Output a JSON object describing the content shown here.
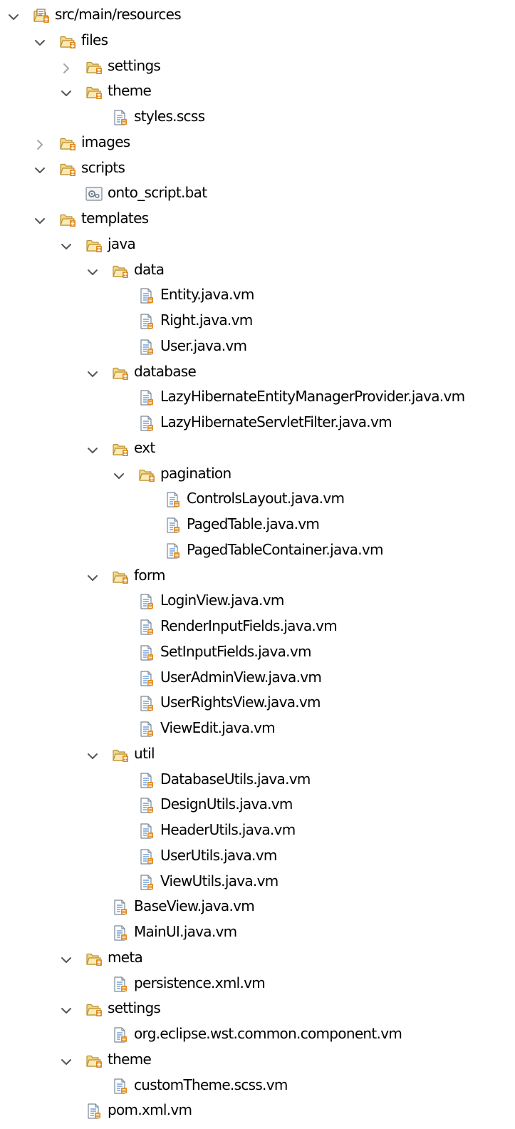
{
  "tree": {
    "nodes": [
      {
        "label": "src/main/resources",
        "depth": 0,
        "kind": "source-folder",
        "expanded": true
      },
      {
        "label": "files",
        "depth": 1,
        "kind": "folder",
        "expanded": true
      },
      {
        "label": "settings",
        "depth": 2,
        "kind": "folder",
        "expanded": false
      },
      {
        "label": "theme",
        "depth": 2,
        "kind": "folder",
        "expanded": true
      },
      {
        "label": "styles.scss",
        "depth": 3,
        "kind": "file"
      },
      {
        "label": "images",
        "depth": 1,
        "kind": "folder",
        "expanded": false
      },
      {
        "label": "scripts",
        "depth": 1,
        "kind": "folder",
        "expanded": true
      },
      {
        "label": "onto_script.bat",
        "depth": 2,
        "kind": "script-file"
      },
      {
        "label": "templates",
        "depth": 1,
        "kind": "folder",
        "expanded": true
      },
      {
        "label": "java",
        "depth": 2,
        "kind": "folder",
        "expanded": true
      },
      {
        "label": "data",
        "depth": 3,
        "kind": "folder",
        "expanded": true
      },
      {
        "label": "Entity.java.vm",
        "depth": 4,
        "kind": "file"
      },
      {
        "label": "Right.java.vm",
        "depth": 4,
        "kind": "file"
      },
      {
        "label": "User.java.vm",
        "depth": 4,
        "kind": "file"
      },
      {
        "label": "database",
        "depth": 3,
        "kind": "folder",
        "expanded": true
      },
      {
        "label": "LazyHibernateEntityManagerProvider.java.vm",
        "depth": 4,
        "kind": "file"
      },
      {
        "label": "LazyHibernateServletFilter.java.vm",
        "depth": 4,
        "kind": "file"
      },
      {
        "label": "ext",
        "depth": 3,
        "kind": "folder",
        "expanded": true
      },
      {
        "label": "pagination",
        "depth": 4,
        "kind": "folder",
        "expanded": true
      },
      {
        "label": "ControlsLayout.java.vm",
        "depth": 5,
        "kind": "file"
      },
      {
        "label": "PagedTable.java.vm",
        "depth": 5,
        "kind": "file"
      },
      {
        "label": "PagedTableContainer.java.vm",
        "depth": 5,
        "kind": "file"
      },
      {
        "label": "form",
        "depth": 3,
        "kind": "folder",
        "expanded": true
      },
      {
        "label": "LoginView.java.vm",
        "depth": 4,
        "kind": "file"
      },
      {
        "label": "RenderInputFields.java.vm",
        "depth": 4,
        "kind": "file"
      },
      {
        "label": "SetInputFields.java.vm",
        "depth": 4,
        "kind": "file"
      },
      {
        "label": "UserAdminView.java.vm",
        "depth": 4,
        "kind": "file"
      },
      {
        "label": "UserRightsView.java.vm",
        "depth": 4,
        "kind": "file"
      },
      {
        "label": "ViewEdit.java.vm",
        "depth": 4,
        "kind": "file"
      },
      {
        "label": "util",
        "depth": 3,
        "kind": "folder",
        "expanded": true
      },
      {
        "label": "DatabaseUtils.java.vm",
        "depth": 4,
        "kind": "file"
      },
      {
        "label": "DesignUtils.java.vm",
        "depth": 4,
        "kind": "file"
      },
      {
        "label": "HeaderUtils.java.vm",
        "depth": 4,
        "kind": "file"
      },
      {
        "label": "UserUtils.java.vm",
        "depth": 4,
        "kind": "file"
      },
      {
        "label": "ViewUtils.java.vm",
        "depth": 4,
        "kind": "file"
      },
      {
        "label": "BaseView.java.vm",
        "depth": 3,
        "kind": "file"
      },
      {
        "label": "MainUI.java.vm",
        "depth": 3,
        "kind": "file"
      },
      {
        "label": "meta",
        "depth": 2,
        "kind": "folder",
        "expanded": true
      },
      {
        "label": "persistence.xml.vm",
        "depth": 3,
        "kind": "file"
      },
      {
        "label": "settings",
        "depth": 2,
        "kind": "folder",
        "expanded": true
      },
      {
        "label": "org.eclipse.wst.common.component.vm",
        "depth": 3,
        "kind": "file"
      },
      {
        "label": "theme",
        "depth": 2,
        "kind": "folder",
        "expanded": true
      },
      {
        "label": "customTheme.scss.vm",
        "depth": 3,
        "kind": "file"
      },
      {
        "label": "pom.xml.vm",
        "depth": 2,
        "kind": "file"
      }
    ]
  },
  "colors": {
    "text": "#000000",
    "chevron": "#555555",
    "chevron_collapsed": "#a6a6a6",
    "folder_fill": "#f5d78a",
    "folder_stroke": "#b8902f",
    "folder_light": "#fbe9b6",
    "badge": "#e08a1c",
    "file_fill": "#ffffff",
    "file_stroke": "#7a8896",
    "file_lines": "#5b8fd0",
    "script_gear": "#6d7a88"
  },
  "icons": {
    "source-folder": "package-folder-icon",
    "folder": "folder-icon",
    "file": "text-file-icon",
    "script-file": "script-file-icon",
    "expanded": "chevron-down-icon",
    "collapsed": "chevron-right-icon"
  }
}
